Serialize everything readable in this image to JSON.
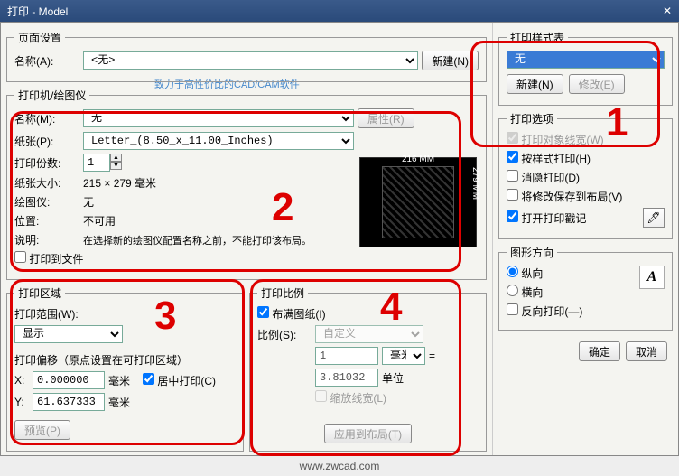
{
  "title": "打印 - Model",
  "page_setup": {
    "legend": "页面设置",
    "name_label": "名称(A):",
    "name_value": "<无>",
    "new_btn": "新建(N)"
  },
  "logo": {
    "text1": "ZWS",
    "text_o": "O",
    "text2": "FT",
    "sub": "致力于高性价比的CAD/CAM软件"
  },
  "printer": {
    "legend": "打印机/绘图仪",
    "name_label": "名称(M):",
    "name_value": "无",
    "props_btn": "属性(R)",
    "paper_label": "纸张(P):",
    "paper_value": "Letter_(8.50_x_11.00_Inches)",
    "copies_label": "打印份数:",
    "copies_value": "1",
    "size_label": "纸张大小:",
    "size_value": "215 × 279  毫米",
    "plotter_label": "绘图仪:",
    "plotter_value": "无",
    "loc_label": "位置:",
    "loc_value": "不可用",
    "desc_label": "说明:",
    "desc_value": "在选择新的绘图仪配置名称之前，不能打印该布局。",
    "tofile_label": "打印到文件",
    "preview_w": "216 MM",
    "preview_h": "279 MM"
  },
  "area": {
    "legend": "打印区域",
    "range_label": "打印范围(W):",
    "range_value": "显示",
    "offset_legend": "打印偏移（原点设置在可打印区域）",
    "x_label": "X:",
    "x_value": "0.000000",
    "y_label": "Y:",
    "y_value": "61.637333",
    "unit": "毫米",
    "center_label": "居中打印(C)",
    "preview_btn": "预览(P)"
  },
  "scale": {
    "legend": "打印比例",
    "fit_label": "布满图纸(I)",
    "scale_label": "比例(S):",
    "scale_value": "自定义",
    "num_value": "1",
    "unit_sel": "毫米",
    "eq": "=",
    "den_value": "3.81032",
    "unit_lbl": "单位",
    "scalelw_label": "缩放线宽(L)",
    "apply_btn": "应用到布局(T)"
  },
  "styletable": {
    "legend": "打印样式表",
    "value": "无",
    "new_btn": "新建(N)",
    "edit_btn": "修改(E)"
  },
  "options": {
    "legend": "打印选项",
    "opt1": "打印对象线宽(W)",
    "opt2": "按样式打印(H)",
    "opt3": "消隐打印(D)",
    "opt4": "将修改保存到布局(V)",
    "opt5": "打开打印戳记"
  },
  "orient": {
    "legend": "图形方向",
    "portrait": "纵向",
    "landscape": "横向",
    "reverse": "反向打印(—)"
  },
  "footer": {
    "ok": "确定",
    "cancel": "取消"
  },
  "url": "www.zwcad.com"
}
